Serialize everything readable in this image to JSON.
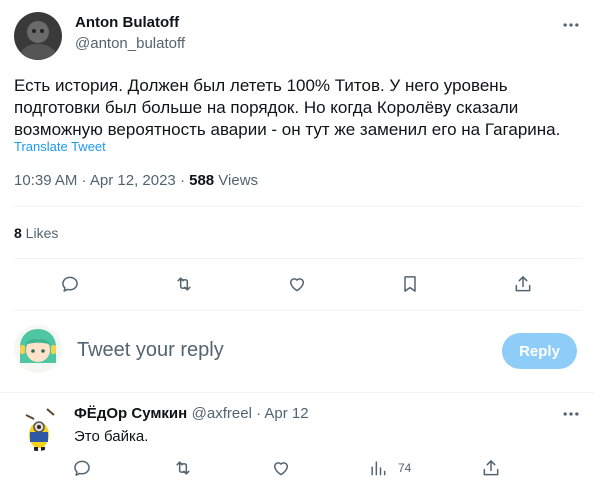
{
  "main_tweet": {
    "author_name": "Anton Bulatoff",
    "author_handle": "@anton_bulatoff",
    "text": "Есть история. Должен был лететь 100% Титов. У него уровень подготовки был больше на порядок. Но когда Королёву сказали возможную вероятность аварии - он тут же заменил его на Гагарина.",
    "translate_label": "Translate Tweet",
    "time": "10:39 AM · Apr 12, 2023 · ",
    "views_count": "588",
    "views_label": " Views",
    "likes_count": "8",
    "likes_label": " Likes"
  },
  "reply_box": {
    "placeholder": "Tweet your reply",
    "button_label": "Reply"
  },
  "reply_tweet": {
    "author_name": "ФЁдОр Сумкин",
    "author_handle": "@axfreel",
    "date": " · Apr 12",
    "text": "Это байка.",
    "views_count": "74"
  },
  "icons": [
    "more-icon",
    "reply-icon",
    "retweet-icon",
    "like-icon",
    "bookmark-icon",
    "share-icon",
    "views-icon"
  ],
  "colors": {
    "link": "#1d9bf0",
    "reply_button": "#8ecdf8",
    "muted": "#536471",
    "text": "#0f1419"
  }
}
